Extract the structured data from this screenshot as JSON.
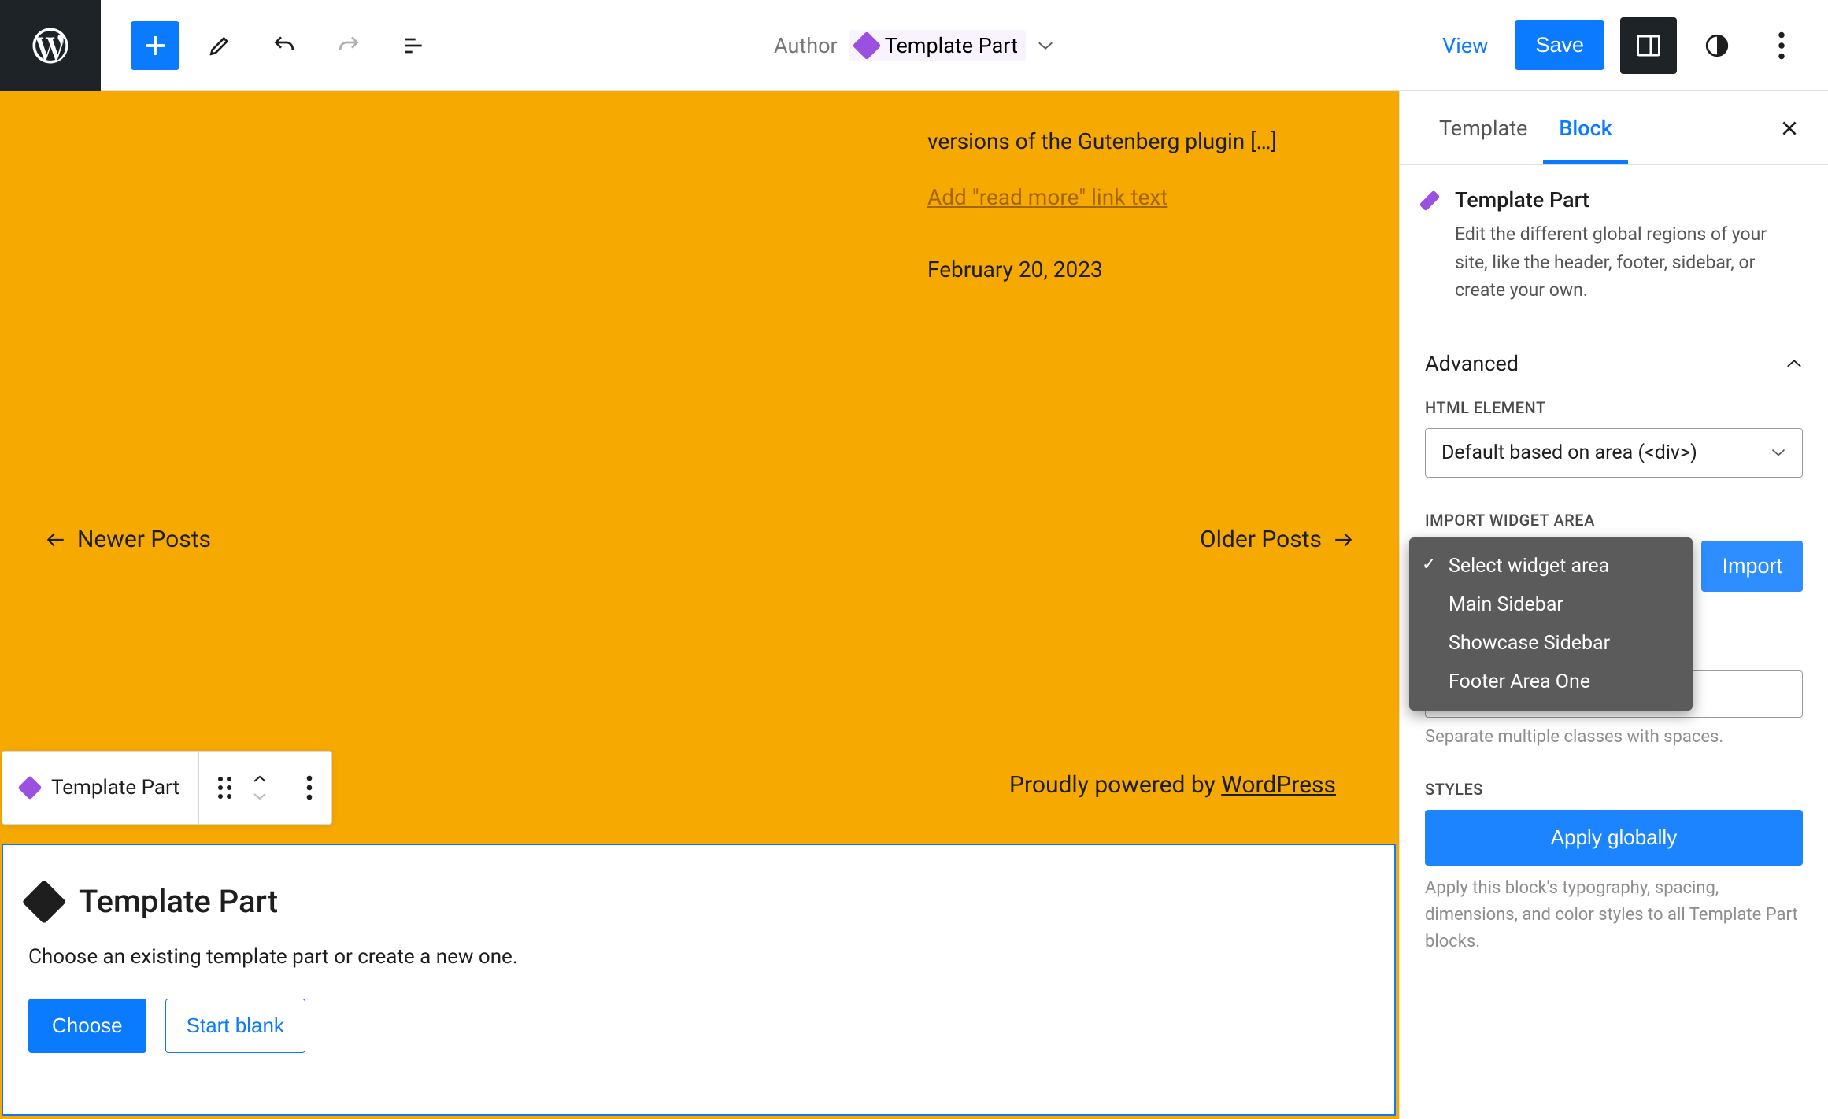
{
  "topbar": {
    "doc_label_prefix": "Author",
    "doc_label": "Template Part",
    "view": "View",
    "save": "Save"
  },
  "canvas": {
    "excerpt": "versions of the Gutenberg plugin […]",
    "read_more": "Add \"read more\" link text",
    "date": "February 20, 2023",
    "newer": "Newer Posts",
    "older": "Older Posts",
    "footer_prefix": "Proudly powered by ",
    "footer_link": "WordPress"
  },
  "block_toolbar": {
    "label": "Template Part"
  },
  "placeholder": {
    "title": "Template Part",
    "desc": "Choose an existing template part or create a new one.",
    "choose": "Choose",
    "start_blank": "Start blank"
  },
  "sidebar": {
    "tabs": {
      "template": "Template",
      "block": "Block"
    },
    "block_card": {
      "title": "Template Part",
      "desc": "Edit the different global regions of your site, like the header, footer, sidebar, or create your own."
    },
    "advanced": {
      "title": "Advanced",
      "html_element_label": "HTML ELEMENT",
      "html_element_value": "Default based on area (<div>)",
      "import_label": "IMPORT WIDGET AREA",
      "import_button": "Import",
      "widget_area_options": [
        "Select widget area",
        "Main Sidebar",
        "Showcase Sidebar",
        "Footer Area One"
      ],
      "css_help": "Separate multiple classes with spaces.",
      "styles_label": "STYLES",
      "apply_globally": "Apply globally",
      "apply_desc": "Apply this block's typography, spacing, dimensions, and color styles to all Template Part blocks."
    }
  }
}
